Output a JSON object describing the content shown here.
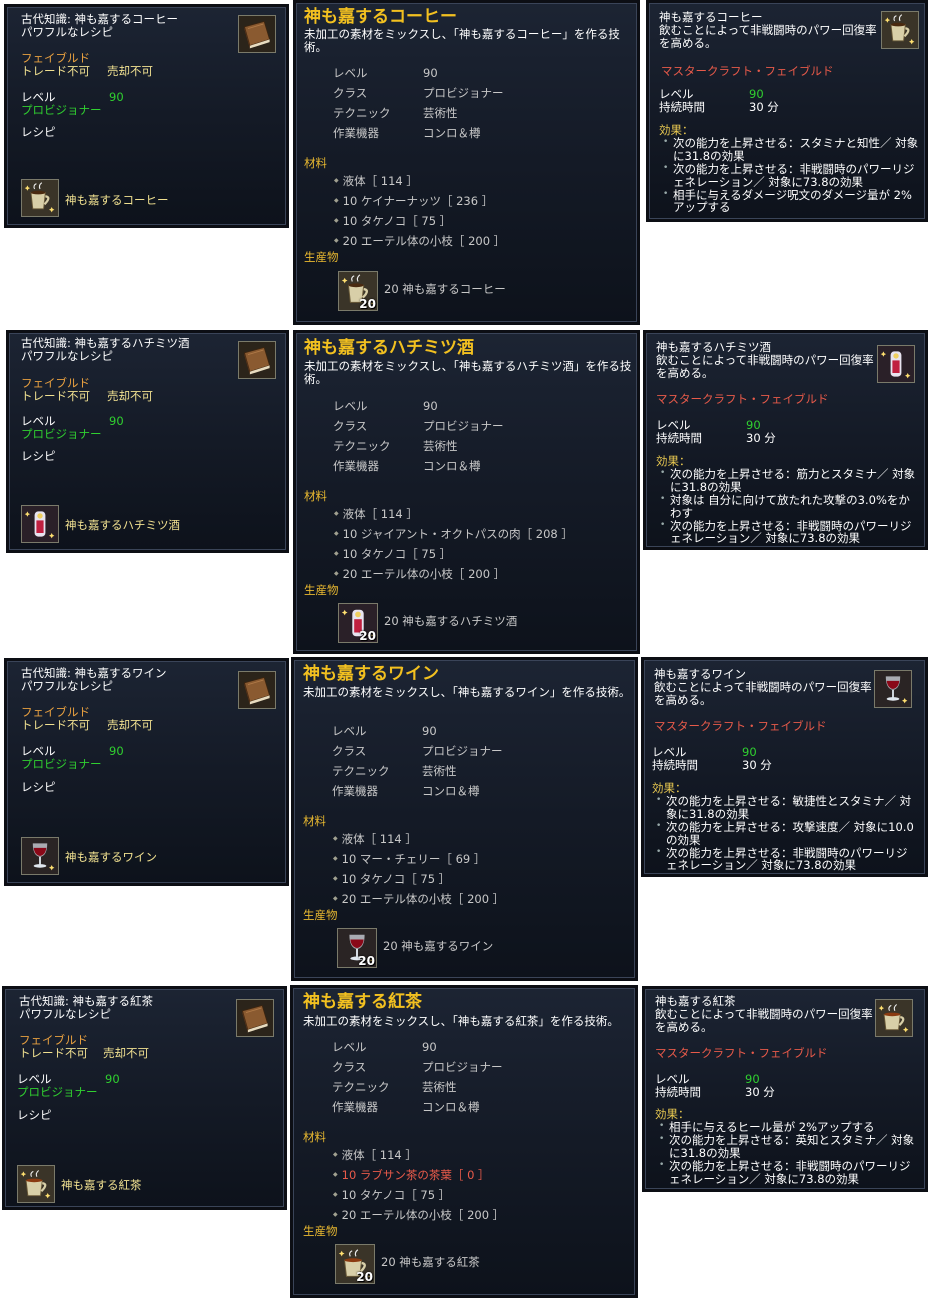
{
  "recipe_book": [
    {
      "title": "古代知識: 神も嘉するコーヒー",
      "subtitle": "パワフルなレシピ",
      "flag": "フェイブルド",
      "no_trade": "トレード不可",
      "no_sell": "売却不可",
      "level_label": "レベル",
      "level": "90",
      "class": "プロビジョナー",
      "type": "レシピ",
      "product": "神も嘉するコーヒー",
      "icon": "coffee-mug-icon"
    },
    {
      "title": "古代知識: 神も嘉するハチミツ酒",
      "subtitle": "パワフルなレシピ",
      "flag": "フェイブルド",
      "no_trade": "トレード不可",
      "no_sell": "売却不可",
      "level_label": "レベル",
      "level": "90",
      "class": "プロビジョナー",
      "type": "レシピ",
      "product": "神も嘉するハチミツ酒",
      "icon": "mead-bottle-icon"
    },
    {
      "title": "古代知識: 神も嘉するワイン",
      "subtitle": "パワフルなレシピ",
      "flag": "フェイブルド",
      "no_trade": "トレード不可",
      "no_sell": "売却不可",
      "level_label": "レベル",
      "level": "90",
      "class": "プロビジョナー",
      "type": "レシピ",
      "product": "神も嘉するワイン",
      "icon": "wine-glass-icon"
    },
    {
      "title": "古代知識: 神も嘉する紅茶",
      "subtitle": "パワフルなレシピ",
      "flag": "フェイブルド",
      "no_trade": "トレード不可",
      "no_sell": "売却不可",
      "level_label": "レベル",
      "level": "90",
      "class": "プロビジョナー",
      "type": "レシピ",
      "product": "神も嘉する紅茶",
      "icon": "tea-cup-icon"
    }
  ],
  "recipe": [
    {
      "title": "神も嘉するコーヒー",
      "desc": "未加工の素材をミックスし、「神も嘉するコーヒー」を作る技術。",
      "level_label": "レベル",
      "level": "90",
      "class_label": "クラス",
      "class": "プロビジョナー",
      "tech_label": "テクニック",
      "tech": "芸術性",
      "device_label": "作業機器",
      "device": "コンロ＆樽",
      "materials_label": "材料",
      "materials": [
        "液体［ 114 ］",
        "10 ケイナーナッツ［ 236 ］",
        "10 タケノコ［ 75 ］",
        "20 エーテル体の小枝［ 200 ］"
      ],
      "product_label": "生産物",
      "product": "20 神も嘉するコーヒー",
      "qty": "20"
    },
    {
      "title": "神も嘉するハチミツ酒",
      "desc": "未加工の素材をミックスし、「神も嘉するハチミツ酒」を作る技術。",
      "level_label": "レベル",
      "level": "90",
      "class_label": "クラス",
      "class": "プロビジョナー",
      "tech_label": "テクニック",
      "tech": "芸術性",
      "device_label": "作業機器",
      "device": "コンロ＆樽",
      "materials_label": "材料",
      "materials": [
        "液体［ 114 ］",
        "10 ジャイアント・オクトパスの肉［ 208 ］",
        "10 タケノコ［ 75 ］",
        "20 エーテル体の小枝［ 200 ］"
      ],
      "product_label": "生産物",
      "product": "20 神も嘉するハチミツ酒",
      "qty": "20"
    },
    {
      "title": "神も嘉するワイン",
      "desc": "未加工の素材をミックスし、「神も嘉するワイン」を作る技術。",
      "level_label": "レベル",
      "level": "90",
      "class_label": "クラス",
      "class": "プロビジョナー",
      "tech_label": "テクニック",
      "tech": "芸術性",
      "device_label": "作業機器",
      "device": "コンロ＆樽",
      "materials_label": "材料",
      "materials": [
        "液体［ 114 ］",
        "10 マー・チェリー［ 69 ］",
        "10 タケノコ［ 75 ］",
        "20 エーテル体の小枝［ 200 ］"
      ],
      "product_label": "生産物",
      "product": "20 神も嘉するワイン",
      "qty": "20"
    },
    {
      "title": "神も嘉する紅茶",
      "desc": "未加工の素材をミックスし、「神も嘉する紅茶」を作る技術。",
      "level_label": "レベル",
      "level": "90",
      "class_label": "クラス",
      "class": "プロビジョナー",
      "tech_label": "テクニック",
      "tech": "芸術性",
      "device_label": "作業機器",
      "device": "コンロ＆樽",
      "materials_label": "材料",
      "materials": [
        "液体［ 114 ］",
        "10 ラブサン茶の茶葉［ 0 ］",
        "10 タケノコ［ 75 ］",
        "20 エーテル体の小枝［ 200 ］"
      ],
      "missing_material_index": 1,
      "product_label": "生産物",
      "product": "20 神も嘉する紅茶",
      "qty": "20"
    }
  ],
  "item": [
    {
      "name": "神も嘉するコーヒー",
      "desc": "飲むことによって非戦闘時のパワー回復率を高める。",
      "tag": "マスタークラフト・フェイブルド",
      "level_label": "レベル",
      "level": "90",
      "duration_label": "持続時間",
      "duration": "30 分",
      "effects_label": "効果：",
      "effects": [
        "次の能力を上昇させる：スタミナと知性／ 対象に31.8の効果",
        "次の能力を上昇させる：非戦闘時のパワーリジェネレーション／ 対象に73.8の効果",
        "相手に与えるダメージ呪文のダメージ量が 2%アップする"
      ]
    },
    {
      "name": "神も嘉するハチミツ酒",
      "desc": "飲むことによって非戦闘時のパワー回復率を高める。",
      "tag": "マスタークラフト・フェイブルド",
      "level_label": "レベル",
      "level": "90",
      "duration_label": "持続時間",
      "duration": "30 分",
      "effects_label": "効果：",
      "effects": [
        "次の能力を上昇させる：筋力とスタミナ／ 対象に31.8の効果",
        "対象は 自分に向けて放たれた攻撃の3.0%をかわす",
        "次の能力を上昇させる：非戦闘時のパワーリジェネレーション／ 対象に73.8の効果"
      ]
    },
    {
      "name": "神も嘉するワイン",
      "desc": "飲むことによって非戦闘時のパワー回復率を高める。",
      "tag": "マスタークラフト・フェイブルド",
      "level_label": "レベル",
      "level": "90",
      "duration_label": "持続時間",
      "duration": "30 分",
      "effects_label": "効果：",
      "effects": [
        "次の能力を上昇させる：敏捷性とスタミナ／ 対象に31.8の効果",
        "次の能力を上昇させる：攻撃速度／ 対象に10.0の効果",
        "次の能力を上昇させる：非戦闘時のパワーリジェネレーション／ 対象に73.8の効果"
      ]
    },
    {
      "name": "神も嘉する紅茶",
      "desc": "飲むことによって非戦闘時のパワー回復率を高める。",
      "tag": "マスタークラフト・フェイブルド",
      "level_label": "レベル",
      "level": "90",
      "duration_label": "持続時間",
      "duration": "30 分",
      "effects_label": "効果：",
      "effects": [
        "相手に与えるヒール量が 2%アップする",
        "次の能力を上昇させる：英知とスタミナ／ 対象に31.8の効果",
        "次の能力を上昇させる：非戦闘時のパワーリジェネレーション／ 対象に73.8の効果"
      ]
    }
  ]
}
